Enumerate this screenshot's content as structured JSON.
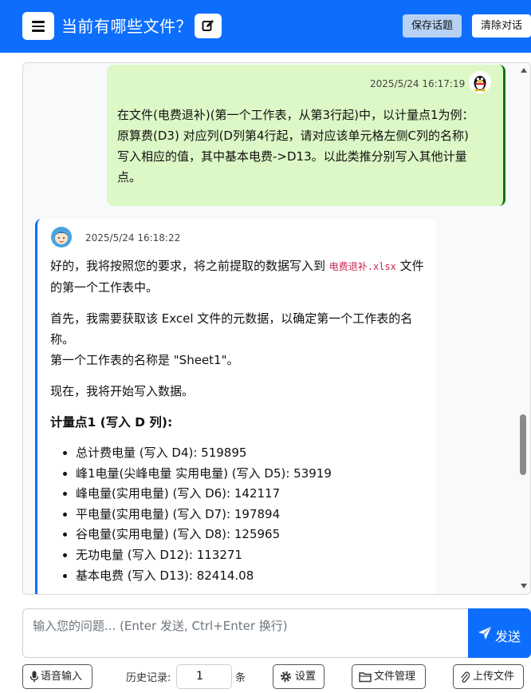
{
  "header": {
    "title": "当前有哪些文件？",
    "save_topic": "保存话题",
    "clear_chat": "清除对话",
    "menu_icon": "hamburger-icon",
    "edit_icon": "edit-icon",
    "bg_color": "#0d6efd"
  },
  "chat": {
    "user_message": {
      "timestamp": "2025/5/24 16:17:19",
      "text": "在文件(电费退补)(第一个工作表，从第3行起)中，以计量点1为例：原算费(D3) 对应列(D列第4行起，请对应该单元格左侧C列的名称)写入相应的值，其中基本电费->D13。以此类推分别写入其他计量点。",
      "avatar_icon": "penguin-icon",
      "bg_color": "#dcf8c6"
    },
    "bot_message": {
      "timestamp": "2025/5/24 16:18:22",
      "avatar_icon": "assistant-avatar-icon",
      "p1_before": "好的，我将按照您的要求，将之前提取的数据写入到 ",
      "p1_code": "电费退补.xlsx",
      "p1_after": " 文件的第一个工作表中。",
      "p2_line1": "首先，我需要获取该 Excel 文件的元数据，以确定第一个工作表的名称。",
      "p2_line2": "第一个工作表的名称是 \"Sheet1\"。",
      "p3": "现在，我将开始写入数据。",
      "heading": "计量点1 (写入 D 列):",
      "items": [
        "总计费电量 (写入 D4): 519895",
        "峰1电量(尖峰电量 实用电量) (写入 D5): 53919",
        "峰电量(实用电量) (写入 D6): 142117",
        "平电量(实用电量) (写入 D7): 197894",
        "谷电量(实用电量) (写入 D8): 125965",
        "无功电量 (写入 D12): 113271",
        "基本电费 (写入 D13): 82414.08"
      ]
    }
  },
  "input": {
    "placeholder": "输入您的问题... (Enter 发送, Ctrl+Enter 换行)",
    "send_label": "发送"
  },
  "bottom": {
    "voice_input": "语音输入",
    "history_label": "历史记录:",
    "history_value": "1",
    "history_unit": "条",
    "settings": "设置",
    "file_manage": "文件管理",
    "upload": "上传文件"
  }
}
